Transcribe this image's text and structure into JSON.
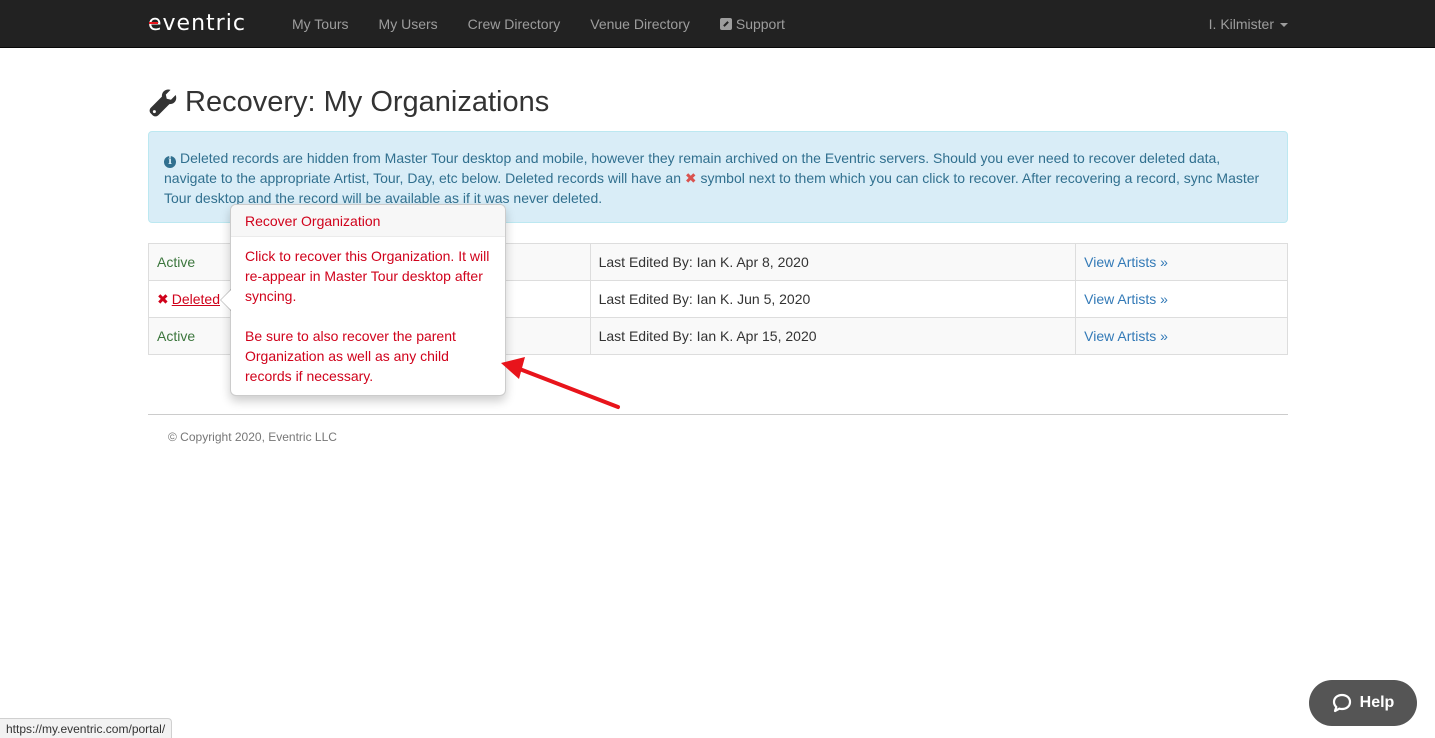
{
  "navbar": {
    "brand": "eventric",
    "links": [
      "My Tours",
      "My Users",
      "Crew Directory",
      "Venue Directory",
      "Support"
    ],
    "user": "I. Kilmister"
  },
  "page": {
    "title": "Recovery: My Organizations"
  },
  "alert": {
    "text_before": "Deleted records are hidden from Master Tour desktop and mobile, however they remain archived on the Eventric servers. Should you ever need to recover deleted data, navigate to the appropriate Artist, Tour, Day, etc below. Deleted records will have an",
    "text_after": "symbol next to them which you can click to recover. After recovering a record, sync Master Tour desktop and the record will be available as if it was never deleted."
  },
  "rows": [
    {
      "status": "Active",
      "last_edited": "Last Edited By: Ian K. Apr 8, 2020",
      "action": "View Artists »"
    },
    {
      "status": "Deleted",
      "last_edited": "Last Edited By: Ian K. Jun 5, 2020",
      "action": "View Artists »"
    },
    {
      "status": "Active",
      "last_edited": "Last Edited By: Ian K. Apr 15, 2020",
      "action": "View Artists »"
    }
  ],
  "popover": {
    "title": "Recover Organization",
    "paragraph1": "Click to recover this Organization. It will re-appear in Master Tour desktop after syncing.",
    "paragraph2": "Be sure to also recover the parent Organization as well as any child records if necessary."
  },
  "footer": {
    "copyright": "© Copyright 2020, Eventric LLC"
  },
  "status_bar": {
    "url": "https://my.eventric.com/portal/"
  },
  "help": {
    "label": "Help"
  },
  "colors": {
    "navbar_bg": "#222222",
    "alert_bg": "#d9edf7",
    "active": "#3c763d",
    "deleted": "#d0021b",
    "link": "#337ab7",
    "arrow": "#e8141b"
  }
}
